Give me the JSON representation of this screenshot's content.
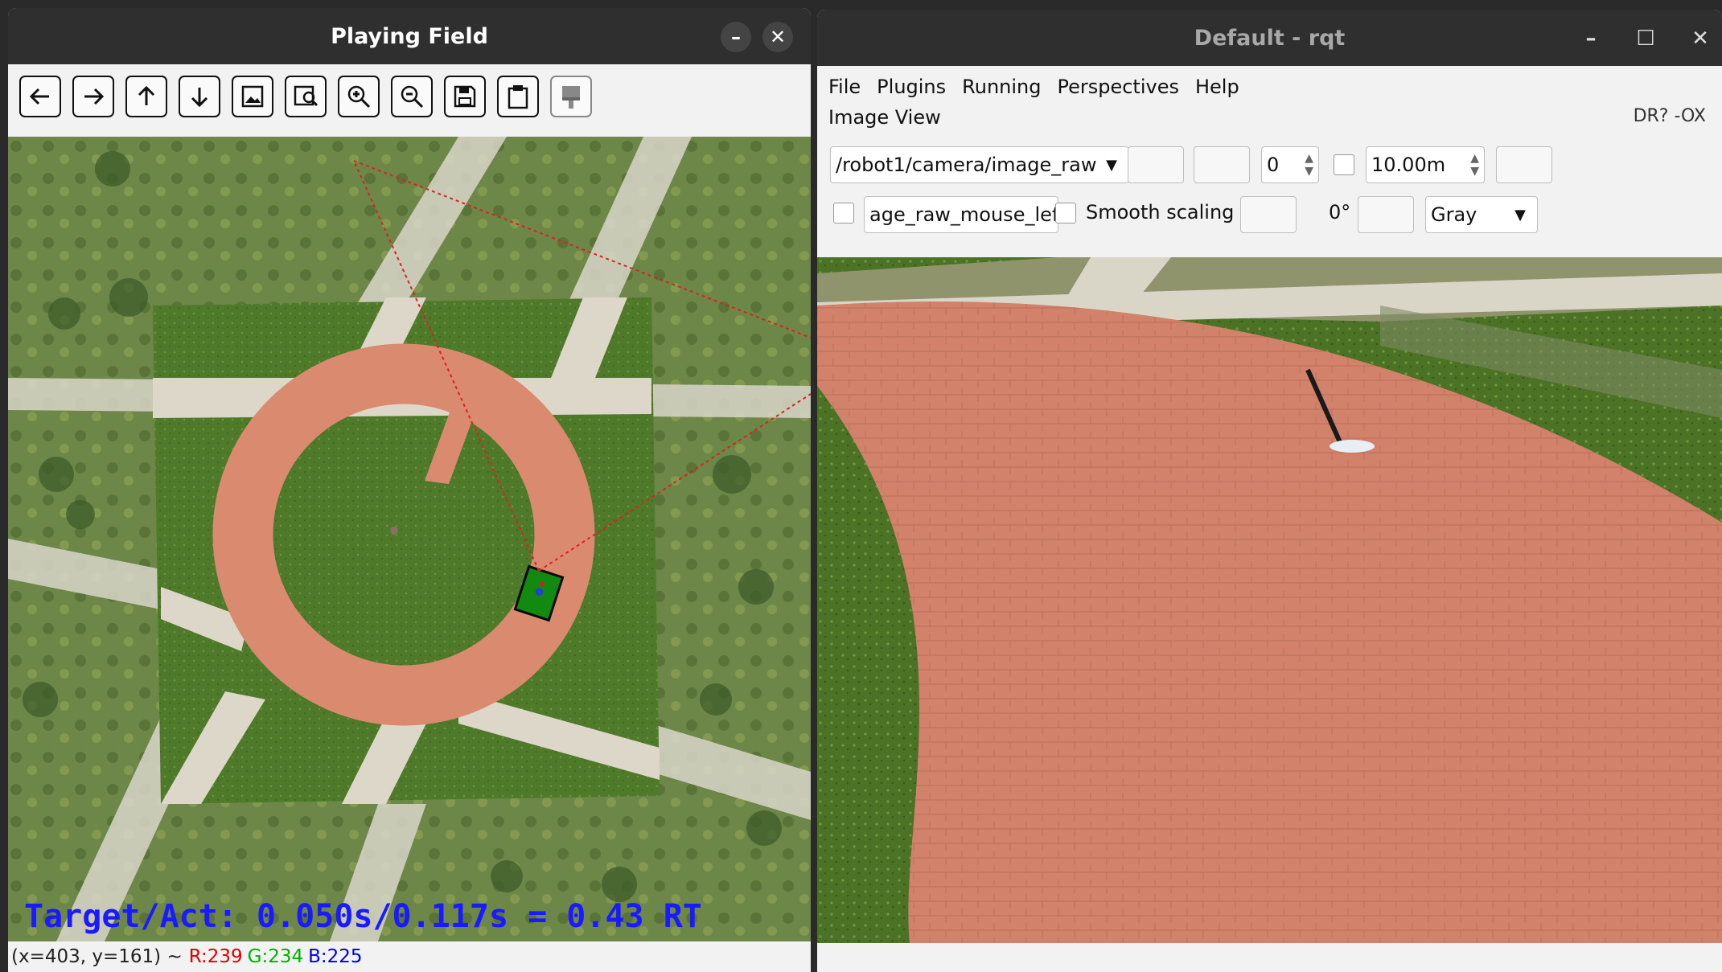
{
  "left_window": {
    "title": "Playing Field",
    "minimize_glyph": "–",
    "close_glyph": "✕",
    "toolbar": [
      {
        "icon": "arrow-left-icon"
      },
      {
        "icon": "arrow-right-icon"
      },
      {
        "icon": "arrow-up-icon"
      },
      {
        "icon": "arrow-down-icon"
      },
      {
        "icon": "image-icon"
      },
      {
        "icon": "image-search-icon"
      },
      {
        "icon": "zoom-in-icon"
      },
      {
        "icon": "zoom-out-icon"
      },
      {
        "icon": "save-icon"
      },
      {
        "icon": "clipboard-icon"
      },
      {
        "icon": "paint-brush-icon"
      }
    ],
    "overlay_text": "Target/Act: 0.050s/0.117s = 0.43 RT",
    "status": {
      "coords": "(x=403, y=161) ~",
      "r": "R:239",
      "g": "G:234",
      "b": "B:225"
    }
  },
  "right_window": {
    "title": "Default - rqt",
    "menu": [
      "File",
      "Plugins",
      "Running",
      "Perspectives",
      "Help"
    ],
    "plugin_title": "Image View",
    "plugin_corner": "DR? -OX",
    "topic": "/robot1/camera/image_raw",
    "spin_value": "0",
    "duration_value": "10.00m",
    "mouse_topic": "age_raw_mouse_left",
    "smooth_scaling_label": "Smooth scaling",
    "rotation_label": "0°",
    "color_scheme": "Gray"
  },
  "colors": {
    "titlebar": "#2f2f2f",
    "overlay_text": "#1a1aff",
    "status_r": "#e00000",
    "status_g": "#00b000",
    "status_b": "#0000e0",
    "path_brick": "#d98a6f",
    "grass": "#4f7a2a"
  }
}
